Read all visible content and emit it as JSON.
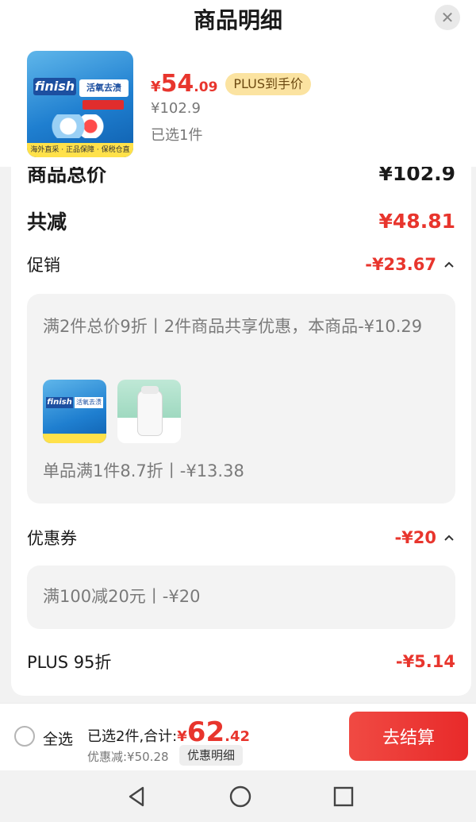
{
  "sheet": {
    "title": "商品明细",
    "close_icon": "close-icon"
  },
  "product": {
    "image_icon": "finish-dishwasher-tablets-image",
    "image_brand": "finish",
    "image_tag": "活氧去渍",
    "image_strip": "海外直采 · 正品保障 · 保税仓直发",
    "price_symbol": "¥",
    "price_int": "54",
    "price_dec": ".09",
    "plus_badge": "PLUS到手价",
    "original_price": "¥102.9",
    "selected_count": "已选1件"
  },
  "summary": {
    "total_label": "商品总价",
    "total_value": "¥102.9",
    "reduced_label": "共减",
    "reduced_value": "¥48.81"
  },
  "promotion": {
    "label": "促销",
    "value": "-¥23.67",
    "line1": "满2件总价9折丨2件商品共享优惠，本商品-¥10.29",
    "line2": "单品满1件8.7折丨-¥13.38",
    "gift1_icon": "finish-product-thumbnail",
    "gift1_brand": "finish",
    "gift1_tag": "活氧去渍",
    "gift2_icon": "ponds-product-thumbnail"
  },
  "coupon": {
    "label": "优惠券",
    "value": "-¥20",
    "line": "满100减20元丨-¥20"
  },
  "plus": {
    "label": "PLUS 95折",
    "value": "-¥5.14"
  },
  "bottom_bar": {
    "select_all": "全选",
    "total_label": "已选2件,合计:",
    "total_symbol": "¥",
    "total_int": "62",
    "total_dec": ".42",
    "discount": "优惠减:¥50.28",
    "detail_chip": "优惠明细",
    "checkout": "去结算"
  },
  "nav": {
    "back_icon": "back-triangle-icon",
    "home_icon": "home-circle-icon",
    "recents_icon": "recents-square-icon"
  },
  "colors": {
    "accent_red": "#e8352d",
    "plus_gold": "#fbe3a1"
  }
}
